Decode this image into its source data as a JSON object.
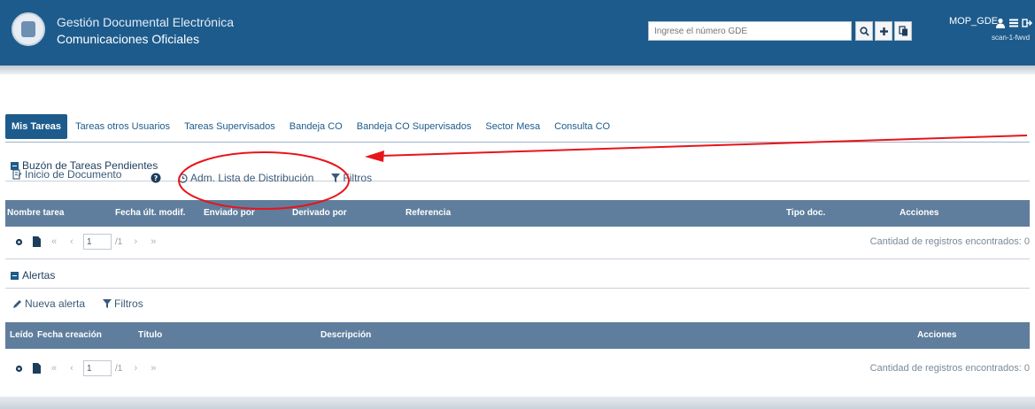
{
  "header": {
    "title": "Gestión Documental Electrónica",
    "subtitle": "Comunicaciones Oficiales",
    "search_placeholder": "Ingrese el número GDE",
    "user": "MOP_GDE",
    "user_sub": "scan-1-fwvd",
    "bg_color": "#1d5b8c"
  },
  "tabs": [
    {
      "label": "Mis Tareas",
      "active": true
    },
    {
      "label": "Tareas otros Usuarios"
    },
    {
      "label": "Tareas Supervisados"
    },
    {
      "label": "Bandeja CO"
    },
    {
      "label": "Bandeja CO Supervisados"
    },
    {
      "label": "Sector Mesa"
    },
    {
      "label": "Consulta CO"
    }
  ],
  "tasks": {
    "section_title": "Buzón de Tareas Pendientes",
    "toolbar": {
      "inicio": "Inicio de Documento",
      "help": "?",
      "adm": "Adm. Lista de Distribución",
      "filtros": "Filtros"
    },
    "columns": [
      "Nombre tarea",
      "Fecha últ. modif.",
      "Enviado por",
      "Derivado por",
      "Referencia",
      "Tipo doc.",
      "Acciones"
    ],
    "pager": {
      "page": "1",
      "total": "/1"
    },
    "count": "Cantidad de registros encontrados: 0"
  },
  "alerts": {
    "section_title": "Alertas",
    "toolbar": {
      "nueva": "Nueva alerta",
      "filtros": "Filtros"
    },
    "columns": [
      "Leído",
      "Fecha creación",
      "Título",
      "Descripción",
      "Acciones"
    ],
    "pager": {
      "page": "1",
      "total": "/1"
    },
    "count": "Cantidad de registros encontrados: 0"
  },
  "annotation": {
    "color": "#e8141a"
  }
}
